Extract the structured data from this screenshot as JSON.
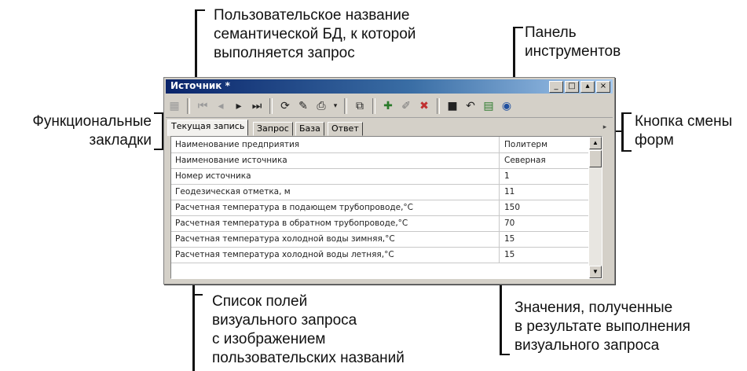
{
  "annotations": {
    "top_db_name": [
      "Пользовательское название",
      "семантической БД, к которой",
      "выполняется запрос"
    ],
    "toolbar_panel": [
      "Панель",
      "инструментов"
    ],
    "functional_tabs": [
      "Функциональные",
      "закладки"
    ],
    "form_switch_button": [
      "Кнопка смены",
      "форм"
    ],
    "field_list": [
      "Список полей",
      "визуального запроса",
      "с изображением",
      "пользовательских названий"
    ],
    "values": [
      "Значения, полученные",
      "в результате выполнения",
      "визуального запроса"
    ]
  },
  "window": {
    "title": "Источник *",
    "controls": [
      "_",
      "□",
      "▴",
      "×"
    ]
  },
  "toolbar": {
    "buttons": [
      "first-record",
      "prev-record",
      "prev",
      "next",
      "last-record",
      "refresh-query",
      "edit-query",
      "print",
      "dropdown",
      "copy",
      "add-record",
      "edit-record",
      "delete-record",
      "save",
      "undo",
      "export-excel",
      "export-web"
    ]
  },
  "tabs": [
    "Текущая запись",
    "Запрос",
    "База",
    "Ответ"
  ],
  "form_switch_glyph": "▸",
  "grid": {
    "rows": [
      {
        "name": "Наименование предприятия",
        "value": "Политерм"
      },
      {
        "name": "Наименование источника",
        "value": "Северная"
      },
      {
        "name": "Номер источника",
        "value": "1"
      },
      {
        "name": "Геодезическая отметка, м",
        "value": "11"
      },
      {
        "name": "Расчетная температура в подающем трубопроводе,°С",
        "value": "150"
      },
      {
        "name": "Расчетная температура в обратном трубопроводе,°С",
        "value": "70"
      },
      {
        "name": "Расчетная температура холодной воды зимняя,°С",
        "value": "15"
      },
      {
        "name": "Расчетная температура холодной воды летняя,°С",
        "value": "15"
      }
    ]
  },
  "colors": {
    "titlebar_start": "#0a246a",
    "titlebar_end": "#a6caf0",
    "window_bg": "#d4d0c8"
  }
}
